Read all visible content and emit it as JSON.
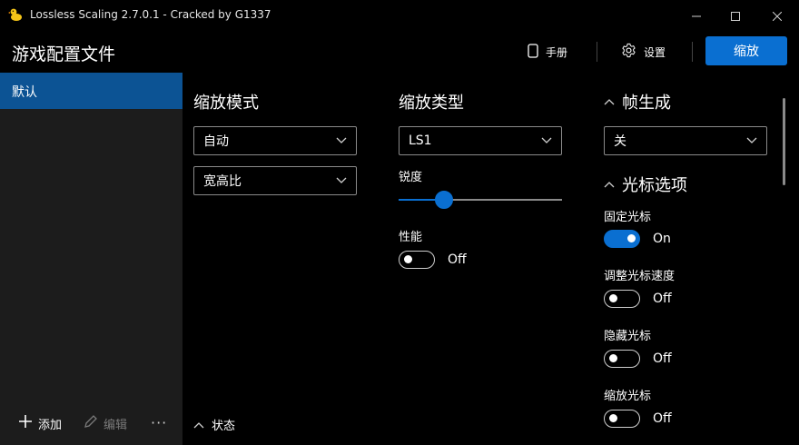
{
  "window": {
    "title": "Lossless Scaling 2.7.0.1 - Cracked by G1337",
    "icon": "duck-icon",
    "controls": [
      "minimize-icon",
      "maximize-icon",
      "close-icon"
    ]
  },
  "header": {
    "title": "游戏配置文件",
    "manual_label": "手册",
    "settings_label": "设置",
    "scale_label": "缩放"
  },
  "sidebar": {
    "items": [
      {
        "label": "默认"
      }
    ],
    "add_label": "添加",
    "edit_label": "编辑",
    "more_label": "···"
  },
  "scaling_mode": {
    "title": "缩放模式",
    "mode_value": "自动",
    "aspect_value": "宽高比"
  },
  "scaling_type": {
    "title": "缩放类型",
    "type_value": "LS1",
    "sharpness_label": "锐度",
    "sharpness_level": 0.28,
    "performance_label": "性能",
    "performance_state": "Off"
  },
  "frame_gen": {
    "title": "帧生成",
    "value": "关"
  },
  "cursor": {
    "title": "光标选项",
    "options": [
      {
        "label": "固定光标",
        "state": "On"
      },
      {
        "label": "调整光标速度",
        "state": "Off"
      },
      {
        "label": "隐藏光标",
        "state": "Off"
      },
      {
        "label": "缩放光标",
        "state": "Off"
      }
    ]
  },
  "status": {
    "label": "状态"
  },
  "colors": {
    "accent": "#0a6fd1",
    "sidebar_bg": "#1c1c1c",
    "sidebar_active": "#0c5394",
    "window_bg": "#000000"
  }
}
